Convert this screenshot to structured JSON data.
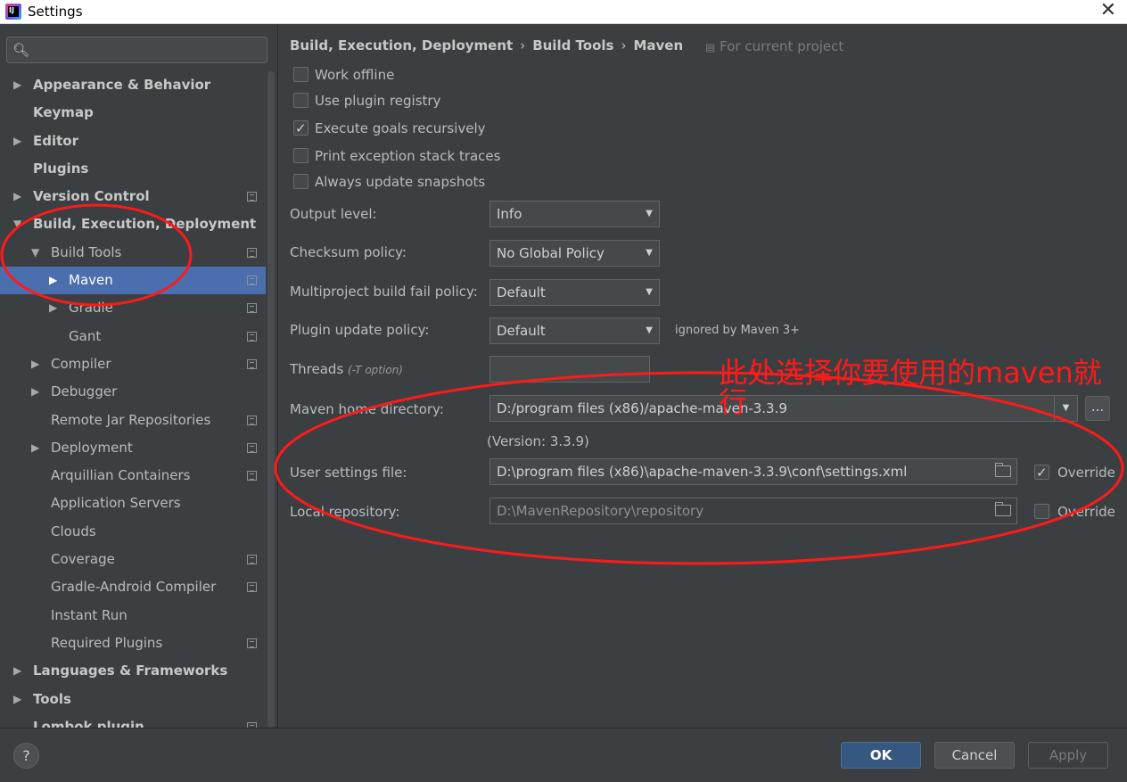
{
  "window": {
    "title": "Settings",
    "close_glyph": "✕"
  },
  "sidebar": {
    "items": [
      {
        "label": "Appearance & Behavior",
        "expandable": true
      },
      {
        "label": "Keymap"
      },
      {
        "label": "Editor",
        "expandable": true
      },
      {
        "label": "Plugins"
      },
      {
        "label": "Version Control",
        "expandable": true
      },
      {
        "label": "Build, Execution, Deployment",
        "expanded": true
      },
      {
        "label": "Build Tools",
        "expanded": true
      },
      {
        "label": "Maven",
        "expandable": true,
        "selected": true
      },
      {
        "label": "Gradle",
        "expandable": true
      },
      {
        "label": "Gant"
      },
      {
        "label": "Compiler",
        "expandable": true
      },
      {
        "label": "Debugger",
        "expandable": true
      },
      {
        "label": "Remote Jar Repositories"
      },
      {
        "label": "Deployment",
        "expandable": true
      },
      {
        "label": "Arquillian Containers"
      },
      {
        "label": "Application Servers"
      },
      {
        "label": "Clouds"
      },
      {
        "label": "Coverage"
      },
      {
        "label": "Gradle-Android Compiler"
      },
      {
        "label": "Instant Run"
      },
      {
        "label": "Required Plugins"
      },
      {
        "label": "Languages & Frameworks",
        "expandable": true
      },
      {
        "label": "Tools",
        "expandable": true
      },
      {
        "label": "Lombok plugin"
      }
    ]
  },
  "breadcrumb": {
    "parts": [
      "Build, Execution, Deployment",
      "Build Tools",
      "Maven"
    ],
    "separator": "›",
    "for_current_project": "For current project"
  },
  "options": {
    "work_offline": {
      "label": "Work offline",
      "checked": false
    },
    "use_plugin_registry": {
      "label": "Use plugin registry",
      "checked": false
    },
    "execute_goals_recursively": {
      "label": "Execute goals recursively",
      "checked": true
    },
    "print_exception_stack_traces": {
      "label": "Print exception stack traces",
      "checked": false
    },
    "always_update_snapshots": {
      "label": "Always update snapshots",
      "checked": false
    }
  },
  "form": {
    "output_level": {
      "label": "Output level:",
      "value": "Info"
    },
    "checksum_policy": {
      "label": "Checksum policy:",
      "value": "No Global Policy"
    },
    "multiproject_fail_policy": {
      "label": "Multiproject build fail policy:",
      "value": "Default"
    },
    "plugin_update_policy": {
      "label": "Plugin update policy:",
      "value": "Default",
      "note": "ignored by Maven 3+"
    },
    "threads": {
      "label": "Threads",
      "hint": "(-T option)",
      "value": ""
    },
    "maven_home": {
      "label": "Maven home directory:",
      "value": "D:/program files (x86)/apache-maven-3.3.9",
      "version": "(Version: 3.3.9)",
      "browse": "..."
    },
    "user_settings": {
      "label": "User settings file:",
      "value": "D:\\program files (x86)\\apache-maven-3.3.9\\conf\\settings.xml",
      "override_label": "Override",
      "override": true
    },
    "local_repository": {
      "label": "Local repository:",
      "value": "D:\\MavenRepository\\repository",
      "override_label": "Override",
      "override": false
    }
  },
  "annotation": {
    "text": "此处选择你要使用的maven就行",
    "color": "#ff1a1a"
  },
  "footer": {
    "help": "?",
    "ok": "OK",
    "cancel": "Cancel",
    "apply": "Apply"
  },
  "colors": {
    "background": "#3c3f41",
    "selection": "#4b6eaf",
    "ok_button": "#365880"
  }
}
